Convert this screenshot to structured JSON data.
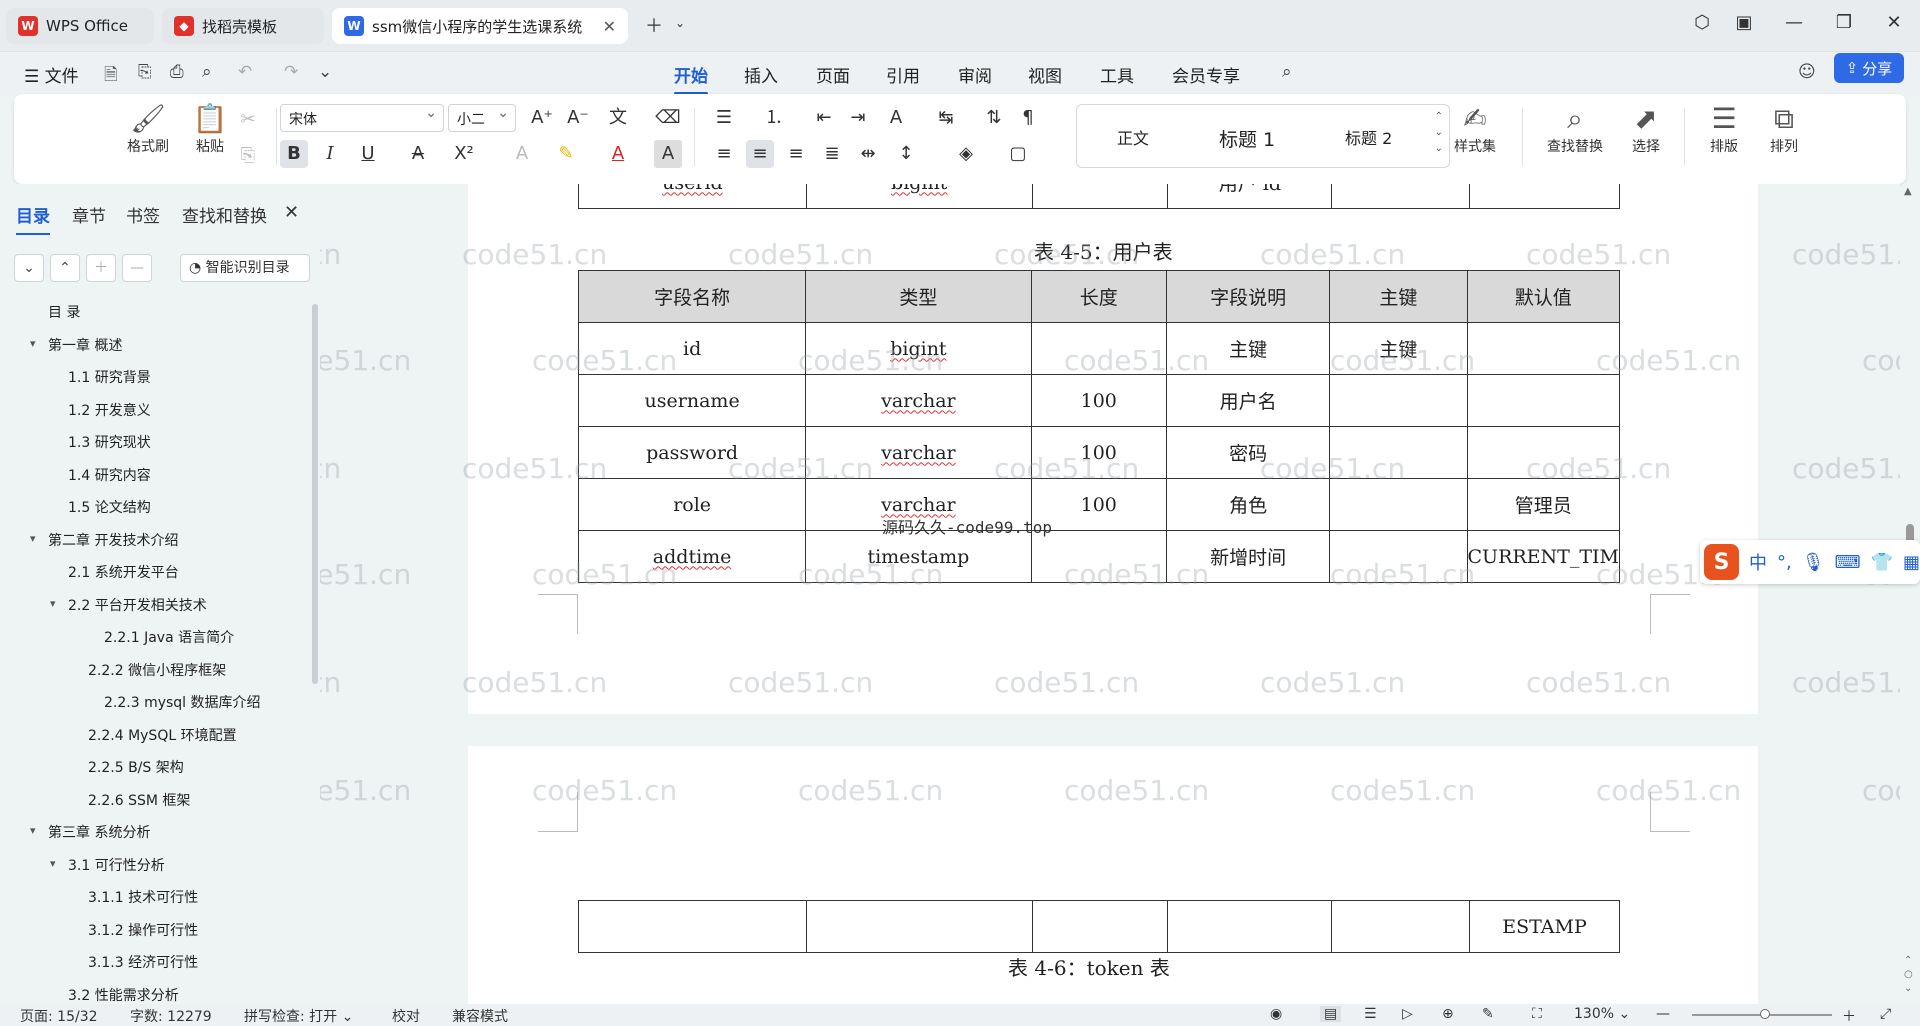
{
  "tabs": [
    {
      "label": "WPS Office",
      "icon": "wps-logo-icon"
    },
    {
      "label": "找稻壳模板",
      "icon": "docer-icon"
    },
    {
      "label": "ssm微信小程序的学生选课系统",
      "icon": "word-doc-icon",
      "active": true
    }
  ],
  "menu": {
    "file": "文件",
    "items": [
      "开始",
      "插入",
      "页面",
      "引用",
      "审阅",
      "视图",
      "工具",
      "会员专享"
    ],
    "share": "分享"
  },
  "ribbon": {
    "format_painter": "格式刷",
    "paste": "粘贴",
    "font": "宋体",
    "size": "小二",
    "styles": [
      "正文",
      "标题 1",
      "标题 2"
    ],
    "style_set": "样式集",
    "find_replace": "查找替换",
    "select": "选择",
    "layout": "排版",
    "arrange": "排列"
  },
  "sidebar": {
    "tabs": [
      "目录",
      "章节",
      "书签",
      "查找和替换"
    ],
    "smart_button": "智能识别目录",
    "toc": [
      {
        "label": "目  录",
        "level": 0
      },
      {
        "label": "第一章  概述",
        "level": 1,
        "arrow": true
      },
      {
        "label": "1.1  研究背景",
        "level": 2
      },
      {
        "label": "1.2  开发意义",
        "level": 2
      },
      {
        "label": "1.3  研究现状",
        "level": 2
      },
      {
        "label": "1.4  研究内容",
        "level": 2
      },
      {
        "label": "1.5  论文结构",
        "level": 2
      },
      {
        "label": "第二章  开发技术介绍",
        "level": 1,
        "arrow": true
      },
      {
        "label": "2.1  系统开发平台",
        "level": 2
      },
      {
        "label": "2.2  平台开发相关技术",
        "level": 2,
        "arrow": true
      },
      {
        "label": "2.2.1    Java 语言简介",
        "level": 4
      },
      {
        "label": "2.2.2    微信小程序框架",
        "level": 3
      },
      {
        "label": "2.2.3    mysql 数据库介绍",
        "level": 4
      },
      {
        "label": "2.2.4    MySQL 环境配置",
        "level": 3
      },
      {
        "label": "2.2.5    B/S 架构",
        "level": 3
      },
      {
        "label": "2.2.6    SSM 框架",
        "level": 3
      },
      {
        "label": "第三章  系统分析",
        "level": 1,
        "arrow": true
      },
      {
        "label": "3.1  可行性分析",
        "level": 2,
        "arrow": true
      },
      {
        "label": "3.1.1  技术可行性",
        "level": 3
      },
      {
        "label": "3.1.2  操作可行性",
        "level": 3
      },
      {
        "label": "3.1.3  经济可行性",
        "level": 3
      },
      {
        "label": "3.2  性能需求分析",
        "level": 2
      }
    ]
  },
  "document": {
    "prev_row": [
      "userid",
      "bigint",
      "",
      "用户 id",
      "",
      ""
    ],
    "table_caption": "表 4-5：用户表",
    "headers": [
      "字段名称",
      "类型",
      "长度",
      "字段说明",
      "主键",
      "默认值"
    ],
    "rows": [
      [
        "id",
        "bigint",
        "",
        "主键",
        "主键",
        ""
      ],
      [
        "username",
        "varchar",
        "100",
        "用户名",
        "",
        ""
      ],
      [
        "password",
        "varchar",
        "100",
        "密码",
        "",
        ""
      ],
      [
        "role",
        "varchar",
        "100",
        "角色",
        "",
        "管理员"
      ],
      [
        "addtime",
        "timestamp",
        "",
        "新增时间",
        "",
        "CURRENT_TIM"
      ]
    ],
    "overflow_row": [
      "",
      "",
      "",
      "",
      "",
      "ESTAMP"
    ],
    "next_caption": "表 4-6：token 表",
    "overlay_text": "源码久久-code99.top",
    "watermark": "code51.cn"
  },
  "ime": {
    "mode": "中"
  },
  "status": {
    "page": "页面: 15/32",
    "words": "字数: 12279",
    "spell": "拼写检查: 打开",
    "proof": "校对",
    "compat": "兼容模式",
    "zoom": "130%"
  },
  "colors": {
    "accent": "#1f5fd6",
    "wps_red": "#e0312b"
  }
}
